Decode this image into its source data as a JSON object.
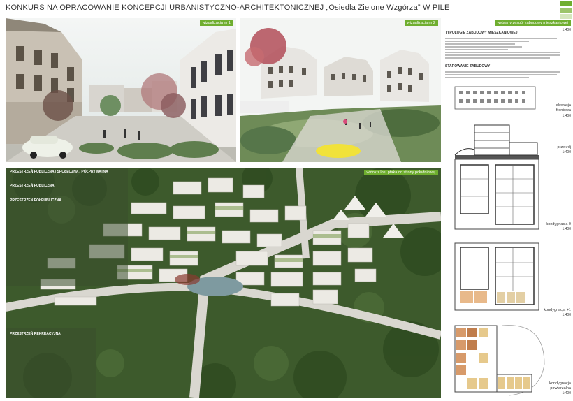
{
  "header": {
    "title_prefix": "KONKURS NA OPRACOWANIE KONCEPCJI URBANISTYCZNO-ARCHITEKTONICZNEJ",
    "title_quote": "„Osiedla Zielone Wzgórza”",
    "title_suffix": "W PILE"
  },
  "colors": {
    "accent_green": "#6fae2f",
    "deco_1": "#6fae2f",
    "deco_2": "#9cc46b",
    "deco_3": "#d5e6bd"
  },
  "vis1": {
    "tag": "wizualizacja nr 1"
  },
  "vis2": {
    "tag": "wizualizacja nr 2"
  },
  "aerial": {
    "tag": "widok z lotu ptaka od strony południowej",
    "heading_1": "PRZESTRZEŃ PUBLICZNA / SPOŁECZNA / PÓŁPRYWATNA",
    "heading_2": "PRZESTRZEŃ PUBLICZNA",
    "heading_3": "PRZESTRZEŃ PÓŁPUBLICZNA",
    "heading_4": "PRZESTRZEŃ REKREACYJNA"
  },
  "typology": {
    "tag": "wybrany zespół zabudowy mieszkaniowej",
    "scale_top": "1:400",
    "heading": "TYPOLOGIE ZABUDOWY MIESZKANIOWEJ",
    "heading_2": "STAROWANIE ZABUDOWY"
  },
  "drawings": [
    {
      "caption": "elewacja frontowa",
      "scale": "1:400"
    },
    {
      "caption": "przekrój",
      "scale": "1:400"
    },
    {
      "caption": "kondygnacja 0",
      "scale": "1:400"
    },
    {
      "caption": "kondygnacja +1",
      "scale": "1:400"
    },
    {
      "caption": "kondygnacja powtarzalna",
      "scale": "1:400"
    }
  ]
}
